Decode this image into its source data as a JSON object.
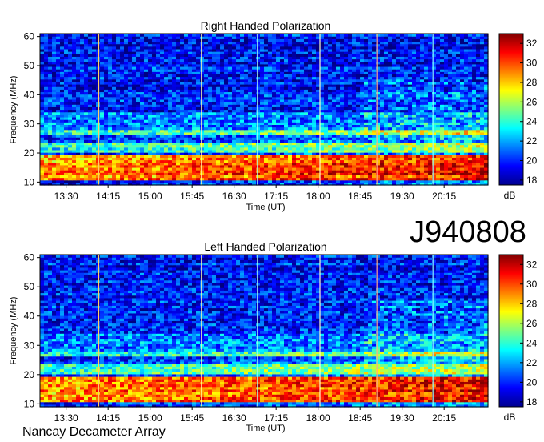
{
  "chart_data": [
    {
      "type": "heatmap",
      "title": "Right Handed Polarization",
      "xlabel": "Time (UT)",
      "ylabel": "Frequency (MHz)",
      "x_ticks": [
        "13:30",
        "14:15",
        "15:00",
        "15:45",
        "16:30",
        "17:15",
        "18:00",
        "18:45",
        "19:30",
        "20:15"
      ],
      "y_ticks": [
        10,
        20,
        30,
        40,
        50,
        60
      ],
      "ylim": [
        9,
        61
      ],
      "colorbar": {
        "label": "dB",
        "ticks": [
          18,
          20,
          22,
          24,
          26,
          28,
          30,
          32
        ],
        "range": [
          17.5,
          33
        ]
      },
      "vertical_lines_ut": [
        "14:05",
        "15:55",
        "16:55",
        "18:02",
        "19:03",
        "20:03"
      ],
      "strong_bands_mhz": [
        [
          11,
          19
        ],
        [
          20,
          24
        ],
        [
          26,
          28
        ]
      ],
      "colormap": "jet"
    },
    {
      "type": "heatmap",
      "title": "Left Handed Polarization",
      "xlabel": "Time (UT)",
      "ylabel": "Frequency (MHz)",
      "x_ticks": [
        "13:30",
        "14:15",
        "15:00",
        "15:45",
        "16:30",
        "17:15",
        "18:00",
        "18:45",
        "19:30",
        "20:15"
      ],
      "y_ticks": [
        10,
        20,
        30,
        40,
        50,
        60
      ],
      "ylim": [
        9,
        61
      ],
      "colorbar": {
        "label": "dB",
        "ticks": [
          18,
          20,
          22,
          24,
          26,
          28,
          30,
          32
        ],
        "range": [
          17.5,
          33
        ]
      },
      "vertical_lines_ut": [
        "14:05",
        "15:55",
        "16:55",
        "18:02",
        "19:03",
        "20:03"
      ],
      "strong_bands_mhz": [
        [
          11,
          19
        ],
        [
          20,
          24
        ],
        [
          26,
          28
        ]
      ],
      "colormap": "jet"
    }
  ],
  "observation_id": "J940808",
  "observatory": "Nancay Decameter Array",
  "colors": {
    "low": "#0000a0",
    "mid": "#00c0ff",
    "high": "#ff0000",
    "max": "#800000"
  }
}
